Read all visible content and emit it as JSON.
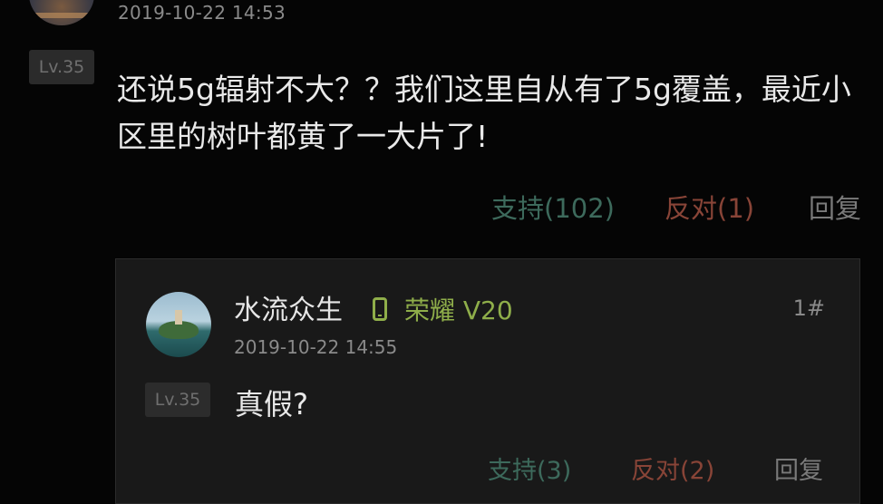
{
  "post": {
    "timestamp": "2019-10-22 14:53",
    "level": "Lv.35",
    "content": "还说5g辐射不大？？我们这里自从有了5g覆盖，最近小区里的树叶都黄了一大片了!",
    "support_label": "支持(102)",
    "oppose_label": "反对(1)",
    "reply_label": "回复"
  },
  "reply": {
    "username": "水流众生",
    "device_icon": "phone-icon",
    "device": "荣耀 V20",
    "floor": "1#",
    "timestamp": "2019-10-22 14:55",
    "level": "Lv.35",
    "content": "真假?",
    "support_label": "支持(3)",
    "oppose_label": "反对(2)",
    "reply_label": "回复"
  },
  "colors": {
    "background": "#050505",
    "support": "#3d6a5c",
    "oppose": "#884437",
    "device": "#8fae4a"
  }
}
